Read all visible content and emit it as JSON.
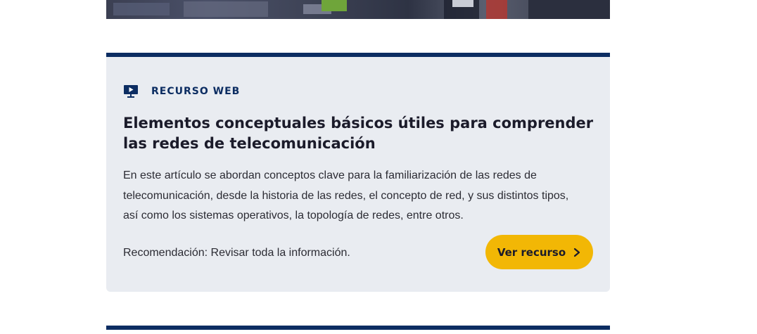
{
  "resource": {
    "type_label": "RECURSO WEB",
    "type_icon": "monitor-play-icon",
    "title": "Elementos conceptuales básicos útiles para comprender las redes de telecomunicación",
    "description": "En este artículo se abordan conceptos clave para la familiarización de las redes de telecomunicación, desde la historia de las redes, el concepto de red, y sus distintos tipos, así como los sistemas operativos, la topología de redes, entre otros.",
    "recommendation": "Recomendación: Revisar toda la información.",
    "button_label": "Ver recurso",
    "button_icon": "chevron-right-icon"
  },
  "colors": {
    "accent_navy": "#0c2d62",
    "button_yellow": "#f2b705",
    "card_background": "#e9ecf1"
  }
}
